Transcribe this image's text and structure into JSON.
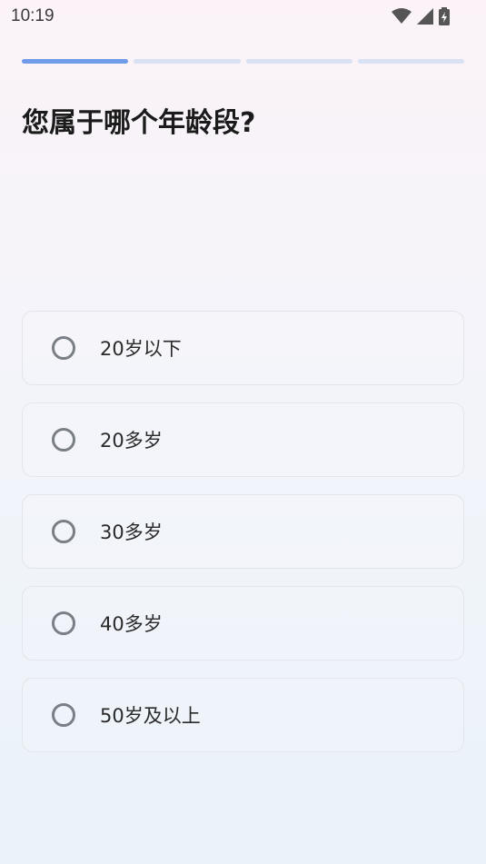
{
  "status_bar": {
    "time": "10:19",
    "icons": [
      "wifi-icon",
      "cellular-signal-icon",
      "battery-charging-icon"
    ]
  },
  "progress": {
    "total_steps": 4,
    "current_step": 1
  },
  "question": {
    "title": "您属于哪个年龄段?"
  },
  "options": [
    {
      "label": "20岁以下",
      "selected": false
    },
    {
      "label": "20多岁",
      "selected": false
    },
    {
      "label": "30多岁",
      "selected": false
    },
    {
      "label": "40多岁",
      "selected": false
    },
    {
      "label": "50岁及以上",
      "selected": false
    }
  ],
  "colors": {
    "progress_active": "#6f9bea",
    "progress_inactive": "#d9e1f4",
    "radio_border": "#7a7f86",
    "option_border": "#e2e6ec"
  }
}
